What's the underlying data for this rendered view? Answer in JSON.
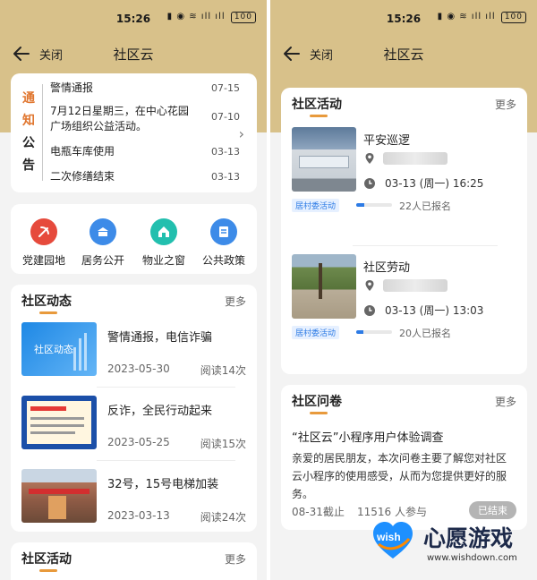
{
  "status": {
    "time": "15:26",
    "battery": "100"
  },
  "nav": {
    "close_label": "关闭",
    "title": "社区云"
  },
  "left": {
    "notice": {
      "label_chars": [
        "通",
        "知",
        "公",
        "告"
      ],
      "items": [
        {
          "title": "警情通报",
          "date": "07-15"
        },
        {
          "title": "7月12日星期三，在中心花园广场组织公益活动。",
          "date": "07-10"
        },
        {
          "title": "电瓶车库使用",
          "date": "03-13"
        },
        {
          "title": "二次修缮结束",
          "date": "03-13"
        }
      ]
    },
    "grid": [
      {
        "label": "党建园地",
        "color": "#e64a3c",
        "icon": "party-icon"
      },
      {
        "label": "居务公开",
        "color": "#3d8be8",
        "icon": "building-icon"
      },
      {
        "label": "物业之窗",
        "color": "#22bfae",
        "icon": "house-icon"
      },
      {
        "label": "公共政策",
        "color": "#3d8be8",
        "icon": "document-icon"
      }
    ],
    "news": {
      "title": "社区动态",
      "more": "更多",
      "items": [
        {
          "title": "警情通报，电信诈骗",
          "date": "2023-05-30",
          "reads": "阅读14次",
          "thumb_text": "社区动态"
        },
        {
          "title": "反诈，全民行动起来",
          "date": "2023-05-25",
          "reads": "阅读15次"
        },
        {
          "title": "32号，15号电梯加装",
          "date": "2023-03-13",
          "reads": "阅读24次"
        }
      ]
    },
    "activities": {
      "title": "社区活动",
      "more": "更多"
    }
  },
  "right": {
    "activities": {
      "title": "社区活动",
      "more": "更多",
      "items": [
        {
          "title": "平安巡逻",
          "time": "03-13 (周一) 16:25",
          "tag": "居村委活动",
          "signups": "22人已报名",
          "progress": 0.22
        },
        {
          "title": "社区劳动",
          "time": "03-13 (周一) 13:03",
          "tag": "居村委活动",
          "signups": "20人已报名",
          "progress": 0.2
        }
      ]
    },
    "survey": {
      "title": "社区问卷",
      "more": "更多",
      "item_title": "“社区云”小程序用户体验调查",
      "desc": "亲爱的居民朋友，本次问卷主要了解您对社区云小程序的使用感受，从而为您提供更好的服务。",
      "deadline": "08-31截止",
      "participants": "11516 人参与",
      "status": "已结束"
    }
  },
  "watermark": {
    "brand": "心愿游戏",
    "url": "www.wishdown.com",
    "logo_text": "wish"
  }
}
